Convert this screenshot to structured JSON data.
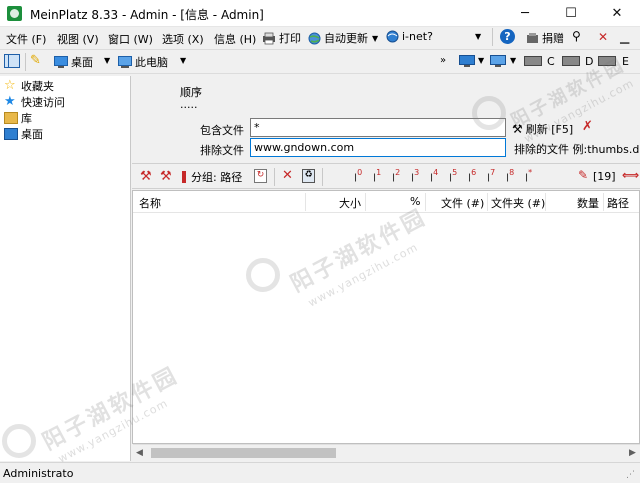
{
  "window": {
    "title": "MeinPlatz 8.33 - Admin - [信息 - Admin]",
    "minimize": "─",
    "maximize": "☐",
    "close": "✕"
  },
  "menu": {
    "items": [
      "文件 (F)",
      "视图 (V)",
      "窗口 (W)",
      "选项 (X)",
      "信息 (H)"
    ],
    "print": "打印",
    "auto_update": "自动更新",
    "inet": "i-net?",
    "donate": "捐赠"
  },
  "toolbar2": {
    "desktop": "桌面",
    "this_pc": "此电脑",
    "drives": [
      "C",
      "D",
      "E"
    ]
  },
  "tree": {
    "items": [
      "收藏夹",
      "快速访问",
      "库",
      "桌面"
    ]
  },
  "filter": {
    "order_label": "顺序",
    "order_dots": ".....",
    "include_label": "包含文件",
    "include_value": "*",
    "exclude_label": "排除文件",
    "exclude_value": "www.gndown.com",
    "refresh_label": "刷新 [F5]",
    "exclude_example": "排除的文件 例:thumbs.db,"
  },
  "toolbar3": {
    "group_label": "分组: 路径",
    "count_label": "[19]",
    "level_numbers": [
      "0",
      "1",
      "2",
      "3",
      "4",
      "5",
      "6",
      "7",
      "8",
      "*"
    ]
  },
  "list": {
    "columns": [
      "名称",
      "大小",
      "%",
      "文件 (#)",
      "文件夹 (#)",
      "数量",
      "路径"
    ]
  },
  "status": {
    "user": "Administrato"
  },
  "watermark": {
    "cn": "阳子湖软件园",
    "url": "www.yangzihu.com"
  },
  "colors": {
    "accent": "#0078d7",
    "red_icon": "#c62828",
    "folder": "#e8b84a"
  }
}
